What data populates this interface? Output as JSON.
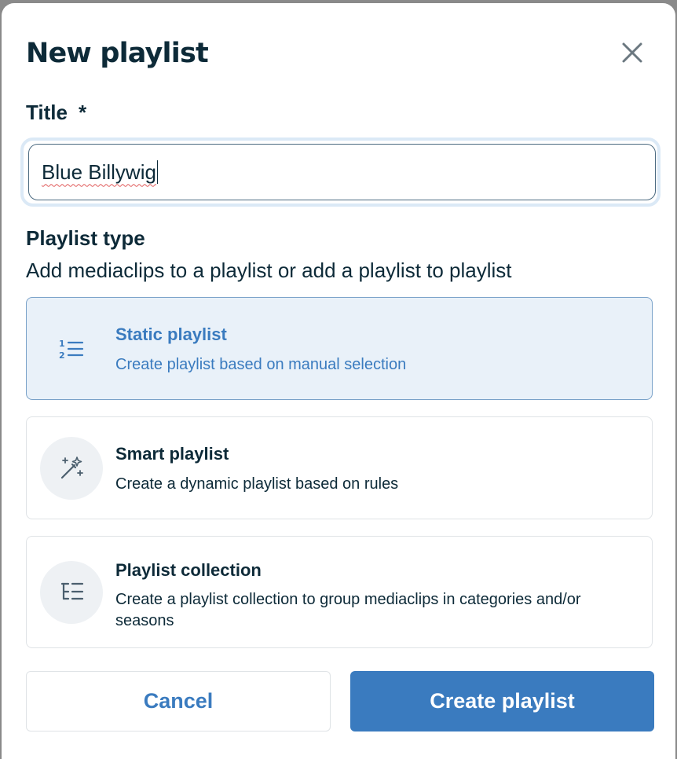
{
  "dialog": {
    "title": "New playlist",
    "close_icon": "close-icon"
  },
  "title_field": {
    "label": "Title",
    "required_marker": "*",
    "value": "Blue Billywig"
  },
  "playlist_type": {
    "label": "Playlist type",
    "description": "Add mediaclips to a playlist or add a playlist to playlist",
    "options": [
      {
        "title": "Static playlist",
        "description": "Create playlist based on manual selection",
        "icon": "numbered-list-icon",
        "selected": true
      },
      {
        "title": "Smart playlist",
        "description": "Create a dynamic playlist based on rules",
        "icon": "magic-wand-icon",
        "selected": false
      },
      {
        "title": "Playlist collection",
        "description": "Create a playlist collection to group mediaclips in categories and/or seasons",
        "icon": "tree-list-icon",
        "selected": false
      }
    ]
  },
  "actions": {
    "cancel_label": "Cancel",
    "create_label": "Create playlist"
  },
  "colors": {
    "accent": "#3a7bbf",
    "text": "#0d2a38",
    "selected_bg": "#e9f1f9"
  }
}
